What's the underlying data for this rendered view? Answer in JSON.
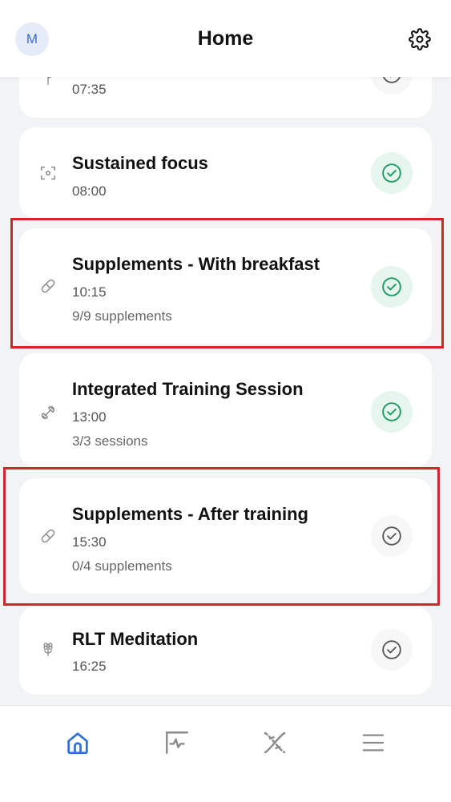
{
  "header": {
    "avatar_initial": "M",
    "title": "Home"
  },
  "cards": [
    {
      "icon": "plant-icon",
      "title": "",
      "time": "07:35",
      "sub": "",
      "status": "pending"
    },
    {
      "icon": "focus-icon",
      "title": "Sustained focus",
      "time": "08:00",
      "sub": "",
      "status": "done"
    },
    {
      "icon": "pill-icon",
      "title": "Supplements - With breakfast",
      "time": "10:15",
      "sub": "9/9 supplements",
      "status": "done"
    },
    {
      "icon": "dumbbell-icon",
      "title": "Integrated Training Session",
      "time": "13:00",
      "sub": "3/3 sessions",
      "status": "done"
    },
    {
      "icon": "pill-icon",
      "title": "Supplements - After training",
      "time": "15:30",
      "sub": "0/4 supplements",
      "status": "pending"
    },
    {
      "icon": "flower-icon",
      "title": "RLT Meditation",
      "time": "16:25",
      "sub": "",
      "status": "pending"
    }
  ],
  "nav": [
    {
      "name": "home",
      "icon": "home-icon",
      "active": true
    },
    {
      "name": "activity",
      "icon": "activity-icon",
      "active": false
    },
    {
      "name": "dna",
      "icon": "dna-icon",
      "active": false
    },
    {
      "name": "menu",
      "icon": "menu-icon",
      "active": false
    }
  ],
  "colors": {
    "accent": "#2f6fdb",
    "done_green": "#1f9c63",
    "done_bg": "#e6f6ee",
    "highlight_red": "#d3262c",
    "icon_gray": "#8a8a8a"
  }
}
